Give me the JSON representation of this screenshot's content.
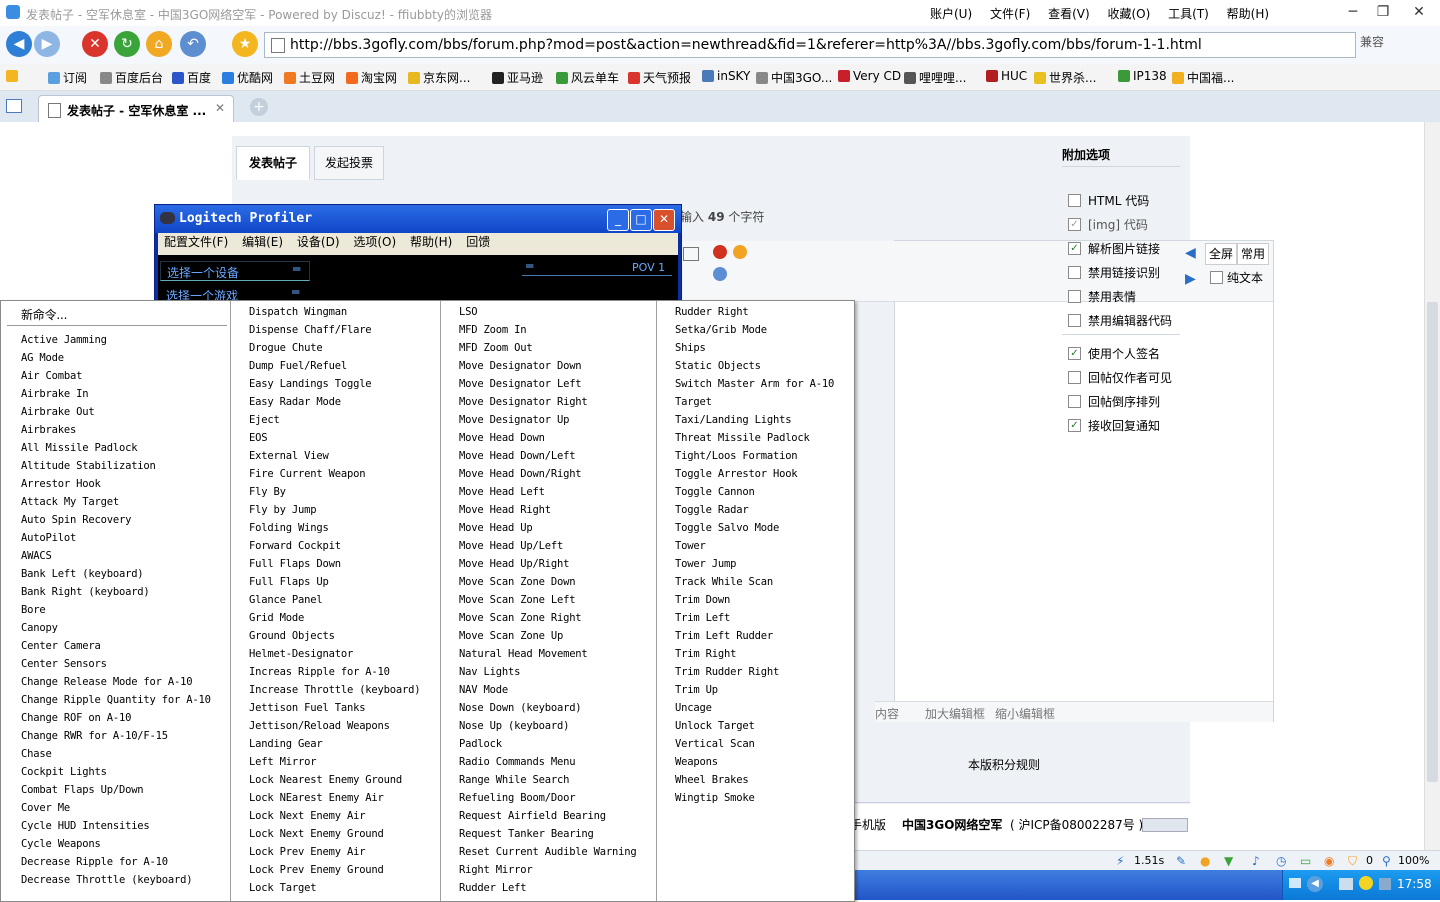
{
  "window": {
    "title": "发表帖子 - 空军休息室 - 中国3GO网络空军 - Powered by Discuz! - ffiubbty的浏览器",
    "menus": [
      "账户(U)",
      "文件(F)",
      "查看(V)",
      "收藏(O)",
      "工具(T)",
      "帮助(H)"
    ]
  },
  "address": {
    "url": "http://bbs.3gofly.com/bbs/forum.php?mod=post&action=newthread&fid=1&referer=http%3A//bbs.3gofly.com/bbs/forum-1-1.html",
    "compat_label": "兼容"
  },
  "favorites": [
    "订阅",
    "百度后台",
    "百度",
    "优酷网",
    "土豆网",
    "淘宝网",
    "京东网...",
    "亚马逊",
    "风云单车",
    "天气预报",
    "inSKY",
    "中国3GO...",
    "Very CD",
    "哩哩哩...",
    "HUC",
    "世界杀...",
    "IP138",
    "中国福..."
  ],
  "tab": {
    "label": "发表帖子 - 空军休息室 ..."
  },
  "form": {
    "tabs": [
      "发表帖子",
      "发起投票"
    ],
    "char_hint_prefix": "输入",
    "char_count": "49",
    "char_hint_suffix": "个字符",
    "toolbar": {
      "fullscreen": "全屏",
      "common": "常用",
      "plain_text": "纯文本"
    },
    "editor_footer": [
      "内容",
      "加大编辑框",
      "缩小编辑框"
    ],
    "rules_link": "本版积分规则"
  },
  "sidebar": {
    "title": "附加选项",
    "options": [
      {
        "label": "HTML 代码",
        "checked": false,
        "enabled": true
      },
      {
        "label": "[img] 代码",
        "checked": true,
        "enabled": false
      },
      {
        "label": "解析图片链接",
        "checked": true,
        "enabled": true
      },
      {
        "label": "禁用链接识别",
        "checked": false,
        "enabled": true
      },
      {
        "label": "禁用表情",
        "checked": false,
        "enabled": true
      },
      {
        "label": "禁用编辑器代码",
        "checked": false,
        "enabled": true
      },
      {
        "label": "使用个人签名",
        "checked": true,
        "enabled": true
      },
      {
        "label": "回帖仅作者可见",
        "checked": false,
        "enabled": true
      },
      {
        "label": "回帖倒序排列",
        "checked": false,
        "enabled": true
      },
      {
        "label": "接收回复通知",
        "checked": true,
        "enabled": true
      }
    ]
  },
  "footer": {
    "mobile": "手机版",
    "site": "中国3GO网络空军",
    "icp": "( 沪ICP备08002287号 )"
  },
  "status": {
    "time": "1.51s",
    "counter": "0",
    "zoom": "100%"
  },
  "taskbar": {
    "clock": "17:58"
  },
  "profiler": {
    "title": "Logitech Profiler",
    "menu": [
      "配置文件(F)",
      "编辑(E)",
      "设备(D)",
      "选项(O)",
      "帮助(H)",
      "回馈"
    ],
    "select_device": "选择一个设备",
    "select_game": "选择一个游戏",
    "pov_label": "POV 1"
  },
  "context_menu": {
    "new_command": "新命令...",
    "col1": [
      "Active Jamming",
      "AG Mode",
      "Air Combat",
      "Airbrake In",
      "Airbrake Out",
      "Airbrakes",
      "All Missile Padlock",
      "Altitude Stabilization",
      "Arrestor Hook",
      "Attack My Target",
      "Auto Spin Recovery",
      "AutoPilot",
      "AWACS",
      "Bank Left (keyboard)",
      "Bank Right (keyboard)",
      "Bore",
      "Canopy",
      "Center Camera",
      "Center Sensors",
      "Change Release Mode for A-10",
      "Change Ripple Quantity for A-10",
      "Change ROF on A-10",
      "Change RWR for A-10/F-15",
      "Chase",
      "Cockpit Lights",
      "Combat Flaps Up/Down",
      "Cover Me",
      "Cycle HUD Intensities",
      "Cycle Weapons",
      "Decrease Ripple for A-10",
      "Decrease Throttle (keyboard)"
    ],
    "col2": [
      "Dispatch Wingman",
      "Dispense Chaff/Flare",
      "Drogue Chute",
      "Dump Fuel/Refuel",
      "Easy Landings Toggle",
      "Easy Radar Mode",
      "Eject",
      "EOS",
      "External View",
      "Fire Current Weapon",
      "Fly By",
      "Fly by Jump",
      "Folding Wings",
      "Forward Cockpit",
      "Full Flaps Down",
      "Full Flaps Up",
      "Glance Panel",
      "Grid Mode",
      "Ground Objects",
      "Helmet-Designator",
      "Increas Ripple for A-10",
      "Increase Throttle (keyboard)",
      "Jettison Fuel Tanks",
      "Jettison/Reload Weapons",
      "Landing Gear",
      "Left Mirror",
      "Lock Nearest Enemy Ground",
      "Lock NEarest Enemy Air",
      "Lock Next Enemy Air",
      "Lock Next Enemy Ground",
      "Lock Prev Enemy Air",
      "Lock Prev Enemy Ground",
      "Lock Target"
    ],
    "col3": [
      "LSO",
      "MFD Zoom In",
      "MFD Zoom Out",
      "Move Designator Down",
      "Move Designator Left",
      "Move Designator Right",
      "Move Designator Up",
      "Move Head Down",
      "Move Head Down/Left",
      "Move Head Down/Right",
      "Move Head Left",
      "Move Head Right",
      "Move Head Up",
      "Move Head Up/Left",
      "Move Head Up/Right",
      "Move Scan Zone Down",
      "Move Scan Zone Left",
      "Move Scan Zone Right",
      "Move Scan Zone Up",
      "Natural Head Movement",
      "Nav Lights",
      "NAV Mode",
      "Nose Down (keyboard)",
      "Nose Up (keyboard)",
      "Padlock",
      "Radio Commands Menu",
      "Range While Search",
      "Refueling Boom/Door",
      "Request Airfield Bearing",
      "Request Tanker Bearing",
      "Reset Current Audible Warning",
      "Right Mirror",
      "Rudder Left"
    ],
    "col4": [
      "Rudder Right",
      "Setka/Grib Mode",
      "Ships",
      "Static Objects",
      "Switch Master Arm for A-10",
      "Target",
      "Taxi/Landing Lights",
      "Threat Missile Padlock",
      "Tight/Loos Formation",
      "Toggle Arrestor Hook",
      "Toggle Cannon",
      "Toggle Radar",
      "Toggle Salvo Mode",
      "Tower",
      "Tower Jump",
      "Track While Scan",
      "Trim Down",
      "Trim Left",
      "Trim Left Rudder",
      "Trim Right",
      "Trim Rudder Right",
      "Trim Up",
      "Uncage",
      "Unlock Target",
      "Vertical Scan",
      "Weapons",
      "Wheel Brakes",
      "Wingtip Smoke"
    ]
  }
}
